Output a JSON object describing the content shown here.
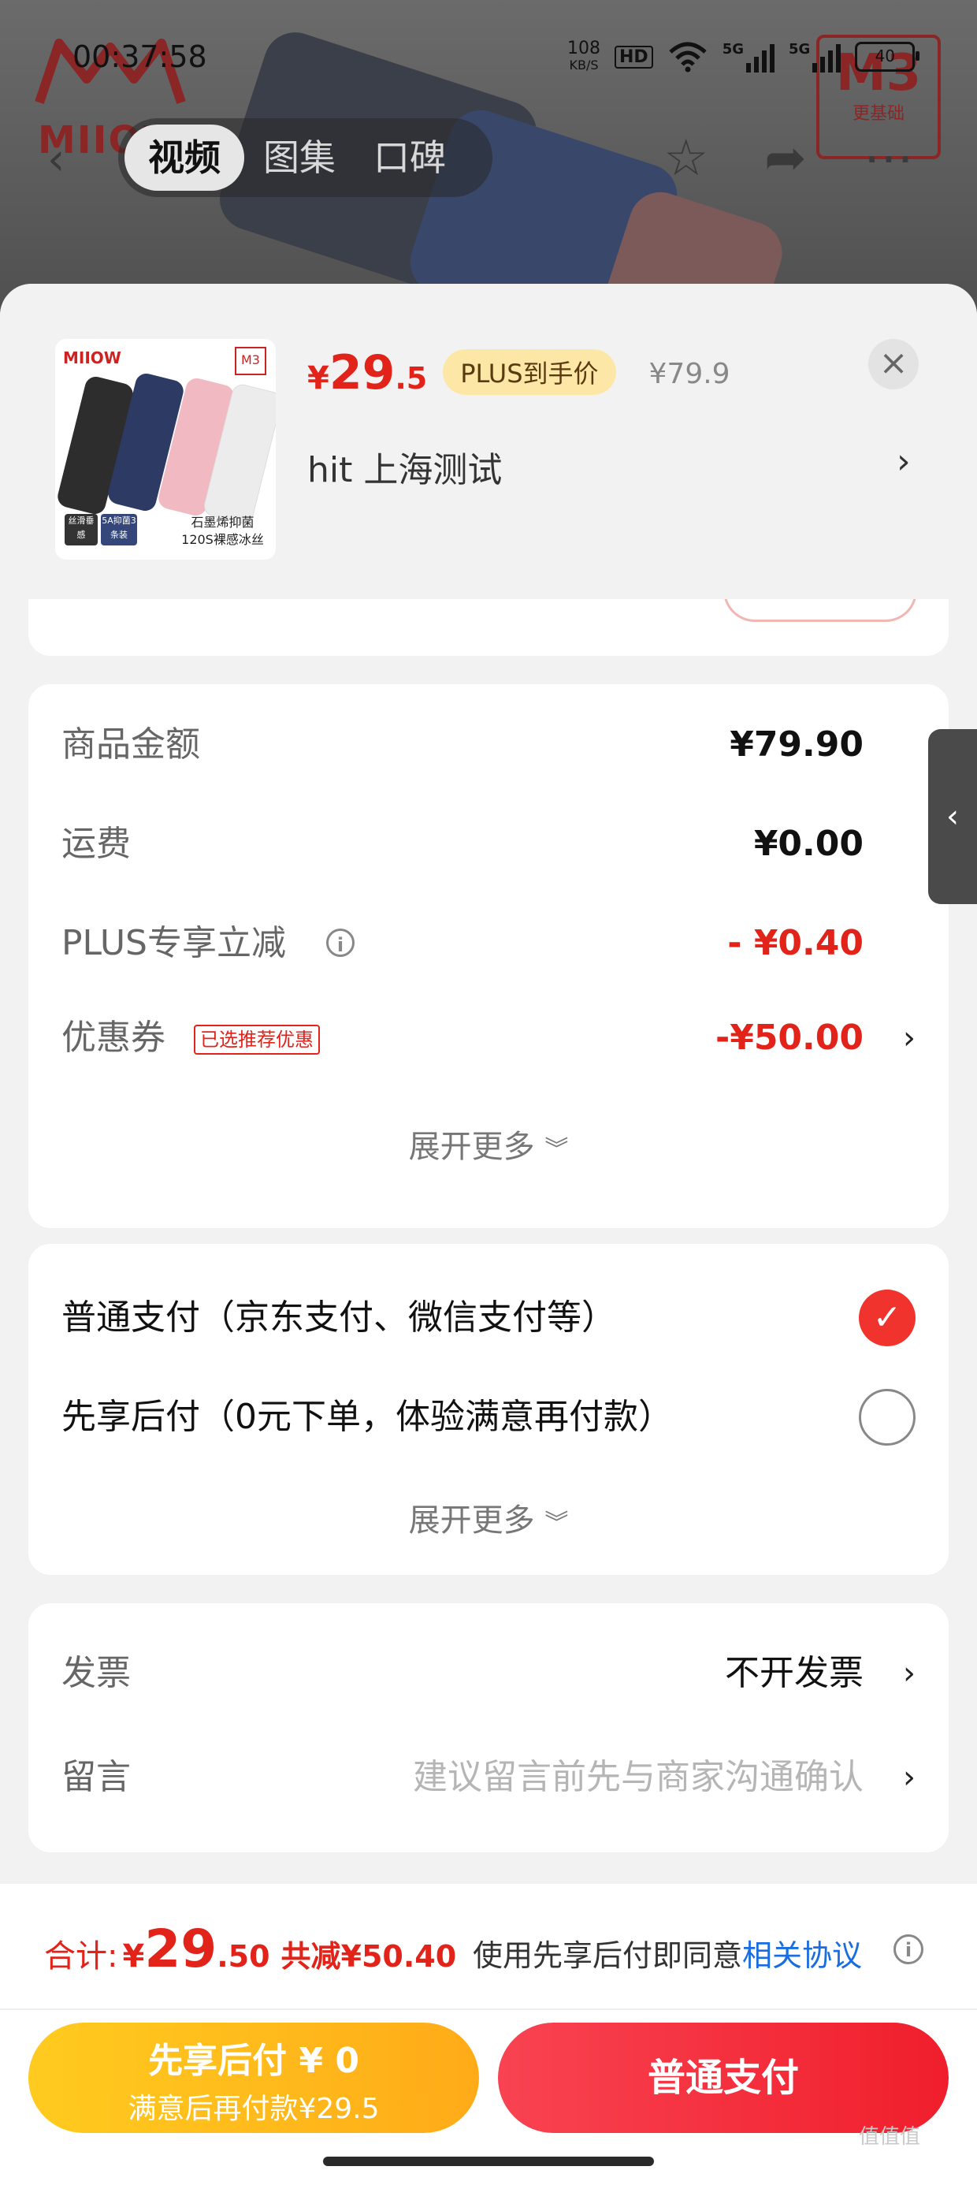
{
  "status_bar": {
    "time": "00:37:58",
    "net_speed_top": "108",
    "net_speed_unit": "KB/S",
    "hd": "HD",
    "sig1": "5G",
    "sig2": "5G",
    "battery": "40"
  },
  "background": {
    "brand": "MIIOW",
    "badge_big": "M3",
    "badge_small": "更基础",
    "media_tabs": [
      "视频",
      "图集",
      "口碑"
    ]
  },
  "product": {
    "price_symbol": "¥",
    "price_int": "29",
    "price_dec": ".5",
    "plus_badge": "PLUS到手价",
    "original_price": "¥79.9",
    "spec": "hit  上海测试",
    "thumb_logo": "MIIOW",
    "thumb_badge": "M3",
    "thumb_tag1": "丝滑垂感",
    "thumb_tag2": "5A抑菌3条装",
    "thumb_caption": "石墨烯抑菌 120S裸感冰丝"
  },
  "cost_card": {
    "rows": [
      {
        "label": "商品金额",
        "value": "¥79.90"
      },
      {
        "label": "运费",
        "value": "¥0.00"
      },
      {
        "label": "PLUS专享立减",
        "value": "- ¥0.40"
      },
      {
        "label": "优惠券",
        "tag": "已选推荐优惠",
        "value": "-¥50.00"
      }
    ],
    "expand": "展开更多"
  },
  "pay_card": {
    "options": [
      {
        "label": "普通支付（京东支付、微信支付等）",
        "selected": true
      },
      {
        "label": "先享后付（0元下单，体验满意再付款）",
        "selected": false
      }
    ],
    "expand": "展开更多"
  },
  "extra_card": {
    "invoice_label": "发票",
    "invoice_value": "不开发票",
    "message_label": "留言",
    "message_placeholder": "建议留言前先与商家沟通确认"
  },
  "bottom": {
    "total_label": "合计:",
    "total_yen": "¥",
    "total_int": "29",
    "total_dec": ".50",
    "total_save": "共减¥50.40",
    "agree_text": "使用先享后付即同意",
    "agree_link": "相关协议",
    "later_line1": "先享后付 ¥ 0",
    "later_line2": "满意后再付款¥29.5",
    "normal_pay": "普通支付"
  },
  "watermark": "值值值",
  "colors": {
    "accent": "#e2231a",
    "link": "#1a6de0",
    "yellow": "#ffbb1c"
  }
}
